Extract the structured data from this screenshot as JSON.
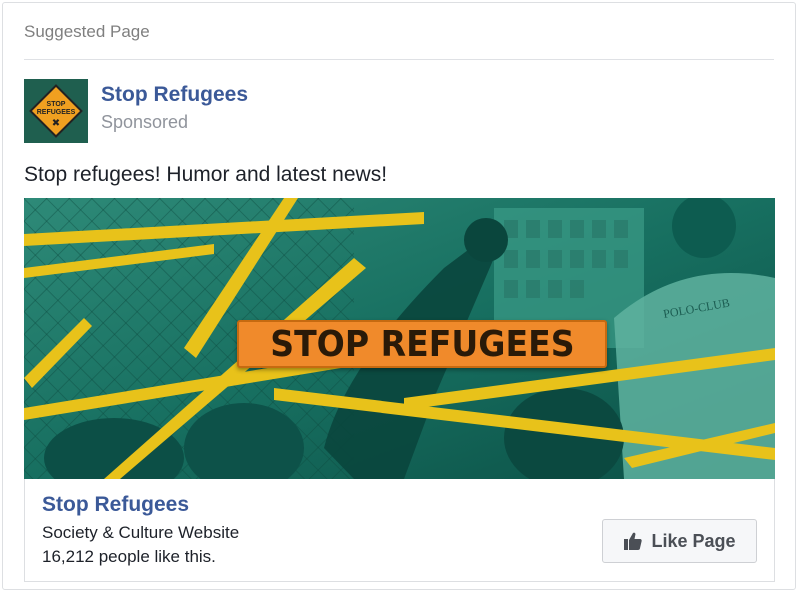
{
  "header": {
    "label": "Suggested Page"
  },
  "post": {
    "page_name": "Stop Refugees",
    "sponsored_label": "Sponsored",
    "text": "Stop refugees! Humor and latest news!",
    "avatar": {
      "icon": "stop-sign-icon",
      "lines": [
        "STOP",
        "REFUGEES"
      ],
      "mark": "✖"
    }
  },
  "media": {
    "banner_text": "STOP REFUGEES",
    "shirt_text": "POLO-CLUB",
    "colors": {
      "tint": "#0f6a5c",
      "tape": "#e8c21a",
      "banner": "#f08a2b"
    }
  },
  "footer": {
    "page_name": "Stop Refugees",
    "category": "Society & Culture Website",
    "likes": "16,212 people like this.",
    "like_button": {
      "icon": "thumbs-up-icon",
      "label": "Like Page"
    }
  },
  "colors": {
    "link": "#3b5998",
    "muted": "#90949c",
    "text": "#1d2129"
  }
}
